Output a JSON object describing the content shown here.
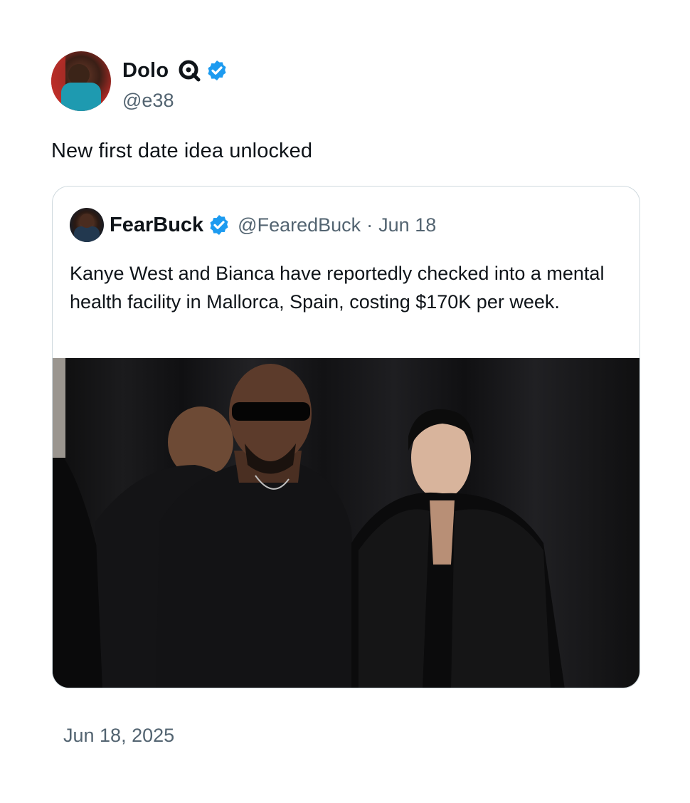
{
  "tweet": {
    "author": {
      "name": "Dolo",
      "handle": "@e38"
    },
    "text": "New first date idea unlocked",
    "date": "Jun 18, 2025"
  },
  "quoted": {
    "author": {
      "name": "FearBuck",
      "handle": "@FearedBuck"
    },
    "separator": "·",
    "date": "Jun 18",
    "text": "Kanye West and Bianca have reportedly checked into a mental health facility in Mallorca, Spain, costing $170K per week."
  },
  "colors": {
    "verified_blue": "#1d9bf0",
    "secondary_text": "#536471",
    "border": "#cfd9de"
  },
  "icons": {
    "affiliation": "magnifier-badge-icon",
    "verified": "verified-badge-icon"
  }
}
